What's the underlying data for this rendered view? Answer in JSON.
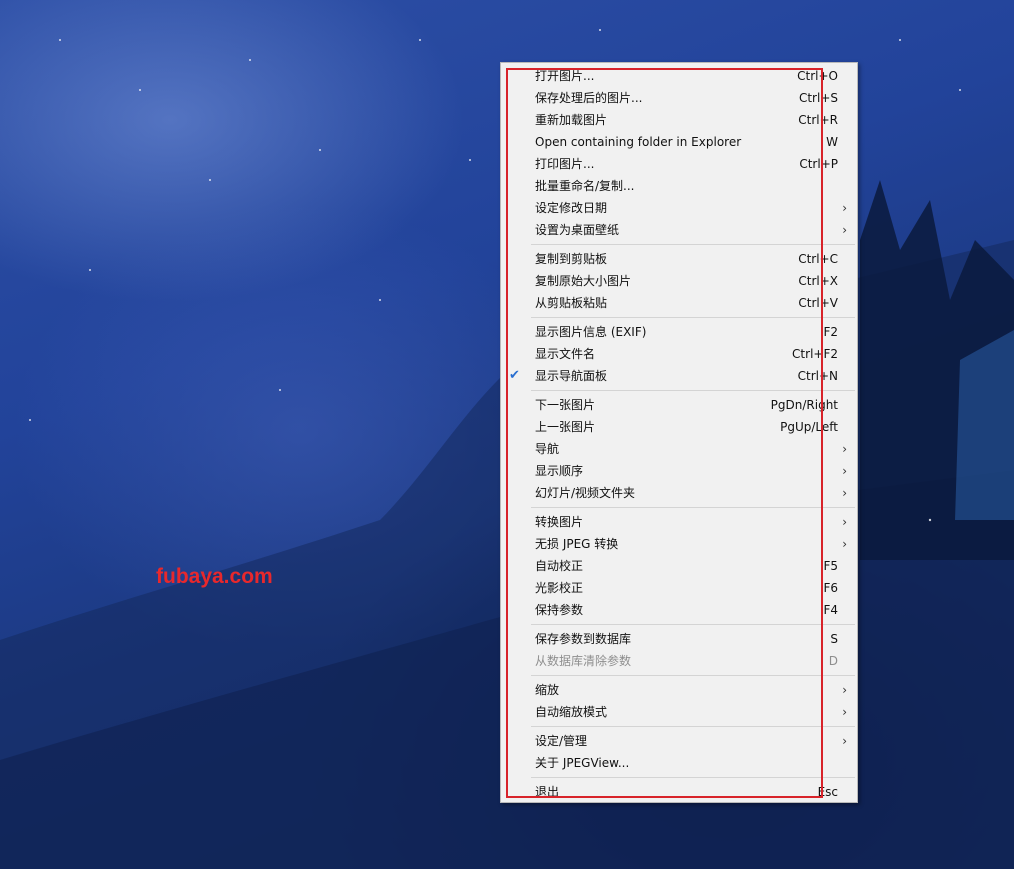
{
  "watermark": "fubaya.com",
  "menu": {
    "items": [
      {
        "label": "打开图片...",
        "shortcut": "Ctrl+O"
      },
      {
        "label": "保存处理后的图片...",
        "shortcut": "Ctrl+S"
      },
      {
        "label": "重新加载图片",
        "shortcut": "Ctrl+R"
      },
      {
        "label": "Open containing folder in Explorer",
        "shortcut": "W"
      },
      {
        "label": "打印图片...",
        "shortcut": "Ctrl+P"
      },
      {
        "label": "批量重命名/复制...",
        "shortcut": ""
      },
      {
        "label": "设定修改日期",
        "shortcut": ""
      },
      {
        "label": "设置为桌面壁纸",
        "shortcut": ""
      },
      {
        "label": "复制到剪贴板",
        "shortcut": "Ctrl+C"
      },
      {
        "label": "复制原始大小图片",
        "shortcut": "Ctrl+X"
      },
      {
        "label": "从剪贴板粘贴",
        "shortcut": "Ctrl+V"
      },
      {
        "label": "显示图片信息 (EXIF)",
        "shortcut": "F2"
      },
      {
        "label": "显示文件名",
        "shortcut": "Ctrl+F2"
      },
      {
        "label": "显示导航面板",
        "shortcut": "Ctrl+N",
        "checked": true
      },
      {
        "label": "下一张图片",
        "shortcut": "PgDn/Right"
      },
      {
        "label": "上一张图片",
        "shortcut": "PgUp/Left"
      },
      {
        "label": "导航",
        "shortcut": ""
      },
      {
        "label": "显示顺序",
        "shortcut": ""
      },
      {
        "label": "幻灯片/视频文件夹",
        "shortcut": ""
      },
      {
        "label": "转换图片",
        "shortcut": ""
      },
      {
        "label": "无损 JPEG 转换",
        "shortcut": ""
      },
      {
        "label": "自动校正",
        "shortcut": "F5"
      },
      {
        "label": "光影校正",
        "shortcut": "F6"
      },
      {
        "label": "保持参数",
        "shortcut": "F4"
      },
      {
        "label": "保存参数到数据库",
        "shortcut": "S"
      },
      {
        "label": "从数据库清除参数",
        "shortcut": "D",
        "disabled": true
      },
      {
        "label": "缩放",
        "shortcut": ""
      },
      {
        "label": "自动缩放模式",
        "shortcut": ""
      },
      {
        "label": "设定/管理",
        "shortcut": ""
      },
      {
        "label": "关于 JPEGView...",
        "shortcut": ""
      },
      {
        "label": "退出",
        "shortcut": "Esc"
      }
    ],
    "submenu_arrow": "›",
    "check_glyph": "✔"
  }
}
